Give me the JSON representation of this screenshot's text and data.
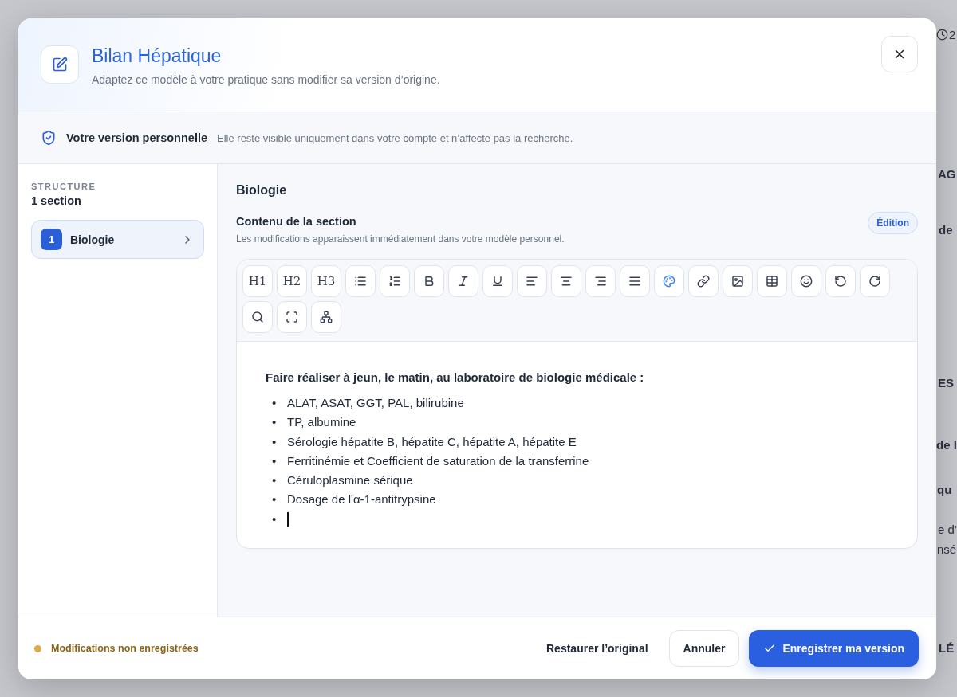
{
  "background": {
    "header_count": "2",
    "fragments": [
      "AG",
      "de",
      "ES",
      "de l",
      "qu",
      "e d'",
      "nsé",
      "LÉ"
    ]
  },
  "dialog": {
    "title": "Bilan Hépatique",
    "subtitle": "Adaptez ce modèle à votre pratique sans modifier sa version d’origine.",
    "notice": {
      "title": "Votre version personnelle",
      "text": "Elle reste visible uniquement dans votre compte et n’affecte pas la recherche."
    },
    "sidebar": {
      "label": "STRUCTURE",
      "count": "1 section",
      "items": [
        {
          "number": "1",
          "label": "Biologie",
          "selected": true
        }
      ]
    },
    "section": {
      "title": "Biologie",
      "content_label": "Contenu de la section",
      "hint": "Les modifications apparaissent immédiatement dans votre modèle personnel.",
      "mode_badge": "Édition"
    },
    "toolbar": [
      {
        "kind": "text",
        "label": "H1"
      },
      {
        "kind": "text",
        "label": "H2"
      },
      {
        "kind": "text",
        "label": "H3"
      },
      {
        "kind": "bullet-list"
      },
      {
        "kind": "numbered-list"
      },
      {
        "kind": "bold"
      },
      {
        "kind": "italic"
      },
      {
        "kind": "underline"
      },
      {
        "kind": "align-left"
      },
      {
        "kind": "align-center"
      },
      {
        "kind": "align-right"
      },
      {
        "kind": "justify"
      },
      {
        "kind": "palette"
      },
      {
        "kind": "link"
      },
      {
        "kind": "image"
      },
      {
        "kind": "table"
      },
      {
        "kind": "emoji"
      },
      {
        "kind": "undo"
      },
      {
        "kind": "redo"
      },
      {
        "kind": "search"
      },
      {
        "kind": "fullscreen"
      },
      {
        "kind": "diagram"
      }
    ],
    "editor": {
      "heading": "Faire réaliser à jeun, le matin, au laboratoire de biologie médicale  :",
      "items": [
        "ALAT, ASAT, GGT, PAL, bilirubine",
        "TP, albumine",
        "Sérologie hépatite B, hépatite C, hépatite A, hépatite E",
        "Ferritinémie et Coefficient de saturation de la transferrine",
        "Céruloplasmine sérique",
        "Dosage de l'α-1-antitrypsine"
      ],
      "bullet": "•",
      "cursor_item": true
    },
    "footer": {
      "status": "Modifications non enregistrées",
      "restore": "Restaurer l’original",
      "cancel": "Annuler",
      "save": "Enregistrer ma version"
    }
  }
}
